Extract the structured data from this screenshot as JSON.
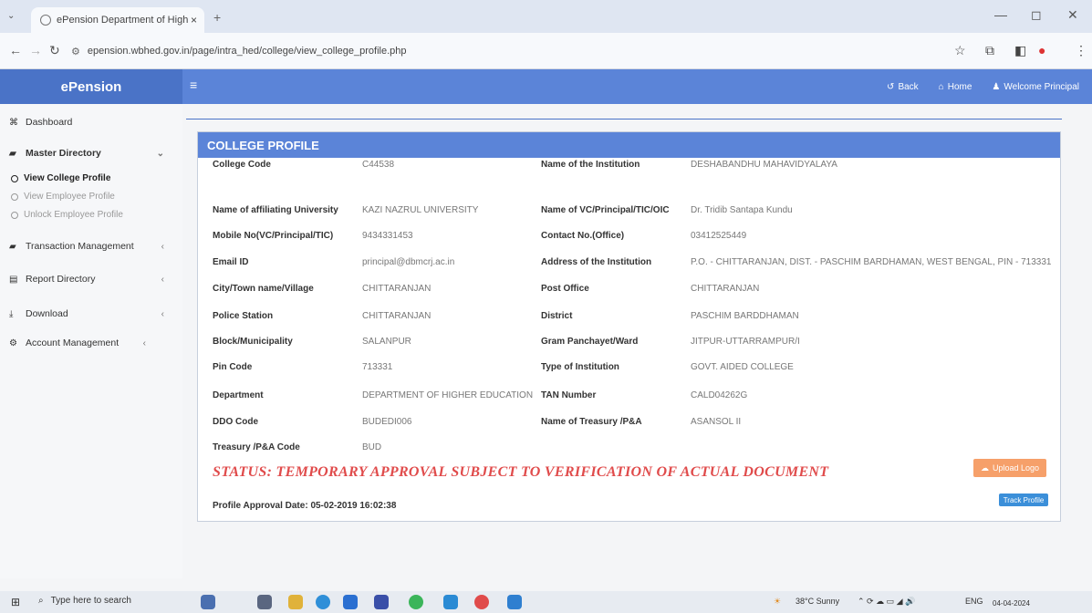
{
  "browser": {
    "tab_title": "ePension Department of High",
    "tab_close": "×",
    "new_tab": "+",
    "url": "epension.wbhed.gov.in/page/intra_hed/college/view_college_profile.php"
  },
  "app": {
    "brand": "ePension",
    "menu_icon": "≡",
    "links": {
      "back": "Back",
      "home": "Home",
      "welcome": "Welcome Principal"
    }
  },
  "sidebar": {
    "dashboard": "Dashboard",
    "master_directory": "Master Directory",
    "sub": {
      "view_college": "View College Profile",
      "view_employee": "View Employee Profile",
      "unlock_employee": "Unlock Employee Profile"
    },
    "transaction": "Transaction Management",
    "report": "Report Directory",
    "download": "Download",
    "account": "Account Management"
  },
  "profile": {
    "title": "COLLEGE PROFILE",
    "fields": {
      "college_code": {
        "label": "College Code",
        "value": "C44538"
      },
      "institution": {
        "label": "Name of the Institution",
        "value": "DESHABANDHU MAHAVIDYALAYA"
      },
      "university": {
        "label": "Name of affiliating University",
        "value": "KAZI NAZRUL UNIVERSITY"
      },
      "vc_name": {
        "label": "Name of VC/Principal/TIC/OIC",
        "value": "Dr. Tridib Santapa Kundu"
      },
      "mobile": {
        "label": "Mobile No(VC/Principal/TIC)",
        "value": "9434331453"
      },
      "contact": {
        "label": "Contact No.(Office)",
        "value": "03412525449"
      },
      "email": {
        "label": "Email ID",
        "value": "principal@dbmcrj.ac.in"
      },
      "address": {
        "label": "Address of the Institution",
        "value": "P.O. - CHITTARANJAN, DIST. - PASCHIM BARDHAMAN, WEST BENGAL, PIN - 713331"
      },
      "city": {
        "label": "City/Town name/Village",
        "value": "CHITTARANJAN"
      },
      "post_office": {
        "label": "Post Office",
        "value": "CHITTARANJAN"
      },
      "police": {
        "label": "Police Station",
        "value": "CHITTARANJAN"
      },
      "district": {
        "label": "District",
        "value": "PASCHIM BARDDHAMAN"
      },
      "block": {
        "label": "Block/Municipality",
        "value": "SALANPUR"
      },
      "gram": {
        "label": "Gram Panchayet/Ward",
        "value": "JITPUR-UTTARRAMPUR/I"
      },
      "pin": {
        "label": "Pin Code",
        "value": "713331"
      },
      "type": {
        "label": "Type of Institution",
        "value": "GOVT. AIDED COLLEGE"
      },
      "department": {
        "label": "Department",
        "value": "DEPARTMENT OF HIGHER EDUCATION"
      },
      "tan": {
        "label": "TAN Number",
        "value": "CALD04262G"
      },
      "ddo": {
        "label": "DDO Code",
        "value": "BUDEDI006"
      },
      "treasury": {
        "label": "Name of Treasury /P&A",
        "value": "ASANSOL II"
      },
      "treasury_code": {
        "label": "Treasury /P&A Code",
        "value": "BUD"
      }
    },
    "status": "STATUS:  TEMPORARY APPROVAL SUBJECT TO VERIFICATION OF ACTUAL DOCUMENT",
    "upload_label": "Upload Logo",
    "approval_label": "Profile Approval Date:",
    "approval_date": "05-02-2019 16:02:38",
    "track_label": "Track Profile"
  },
  "taskbar": {
    "search": "Type here to search",
    "weather": "38°C  Sunny",
    "lang": "ENG",
    "date": "04-04-2024"
  }
}
